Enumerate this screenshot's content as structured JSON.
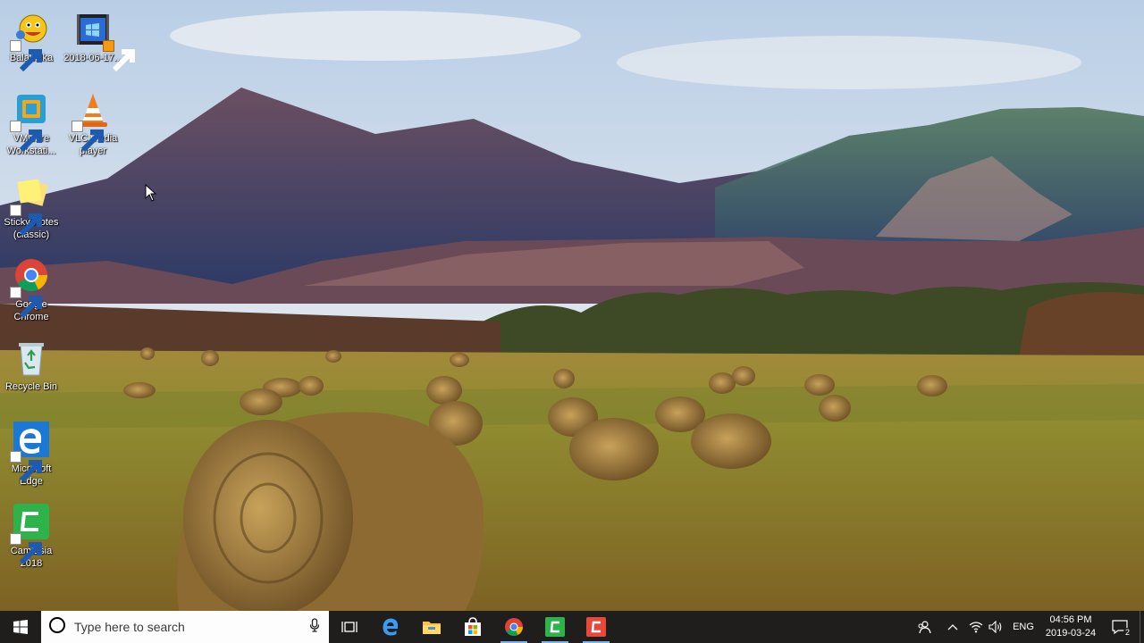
{
  "desktop": {
    "icons": [
      {
        "label": "Balabolka",
        "icon": "balabolka-icon"
      },
      {
        "label": "2018-06-17...",
        "icon": "video-file-icon"
      },
      {
        "label": "VMware Workstati...",
        "icon": "vmware-icon"
      },
      {
        "label": "VLC media player",
        "icon": "vlc-icon"
      },
      {
        "label": "Sticky Notes (classic)",
        "icon": "sticky-notes-icon"
      },
      {
        "label": "Google Chrome",
        "icon": "chrome-icon"
      },
      {
        "label": "Recycle Bin",
        "icon": "recycle-bin-icon"
      },
      {
        "label": "Microsoft Edge",
        "icon": "edge-icon"
      },
      {
        "label": "Camtasia 2018",
        "icon": "camtasia-icon"
      }
    ],
    "wallpaper": "hay-bales-mountains"
  },
  "taskbar": {
    "start_icon": "windows-start-icon",
    "search": {
      "placeholder": "Type here to search",
      "icon": "cortana-circle-icon",
      "mic_icon": "microphone-icon"
    },
    "pinned": [
      {
        "name": "task-view",
        "icon": "task-view-icon"
      },
      {
        "name": "edge",
        "icon": "edge-icon"
      },
      {
        "name": "file-explorer",
        "icon": "folder-icon"
      },
      {
        "name": "store",
        "icon": "store-icon"
      },
      {
        "name": "chrome",
        "icon": "chrome-icon",
        "running": true
      },
      {
        "name": "camtasia",
        "icon": "camtasia-icon",
        "running": true
      },
      {
        "name": "camtasia-recorder",
        "icon": "camtasia-recorder-icon",
        "running": true
      }
    ],
    "tray": {
      "language": "ENG",
      "time": "04:56 PM",
      "date": "2019-03-24",
      "notification_count": "2"
    }
  },
  "colors": {
    "taskbar_bg": "#1f1e1c",
    "running_indicator": "#7cb3e8",
    "camtasia_green": "#2db34a",
    "recorder_red": "#e8483a"
  }
}
